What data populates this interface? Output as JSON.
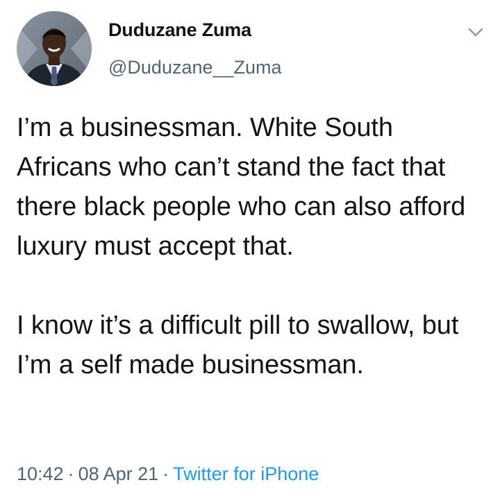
{
  "author": {
    "display_name": "Duduzane Zuma",
    "handle": "@Duduzane__Zuma"
  },
  "tweet": {
    "text": "I’m a businessman. White South Africans who can’t stand the fact that there black people who can also afford luxury must accept that.\n\nI know it’s a difficult pill to swallow, but I’m a self made businessman."
  },
  "meta": {
    "time": "10:42",
    "separator": "·",
    "date": "08 Apr 21",
    "source": "Twitter for iPhone"
  },
  "icons": {
    "caret": "chevron-down-icon",
    "avatar": "profile-photo"
  },
  "colors": {
    "text_primary": "#0f1419",
    "text_secondary": "#536471",
    "link": "#1d9bf0"
  }
}
